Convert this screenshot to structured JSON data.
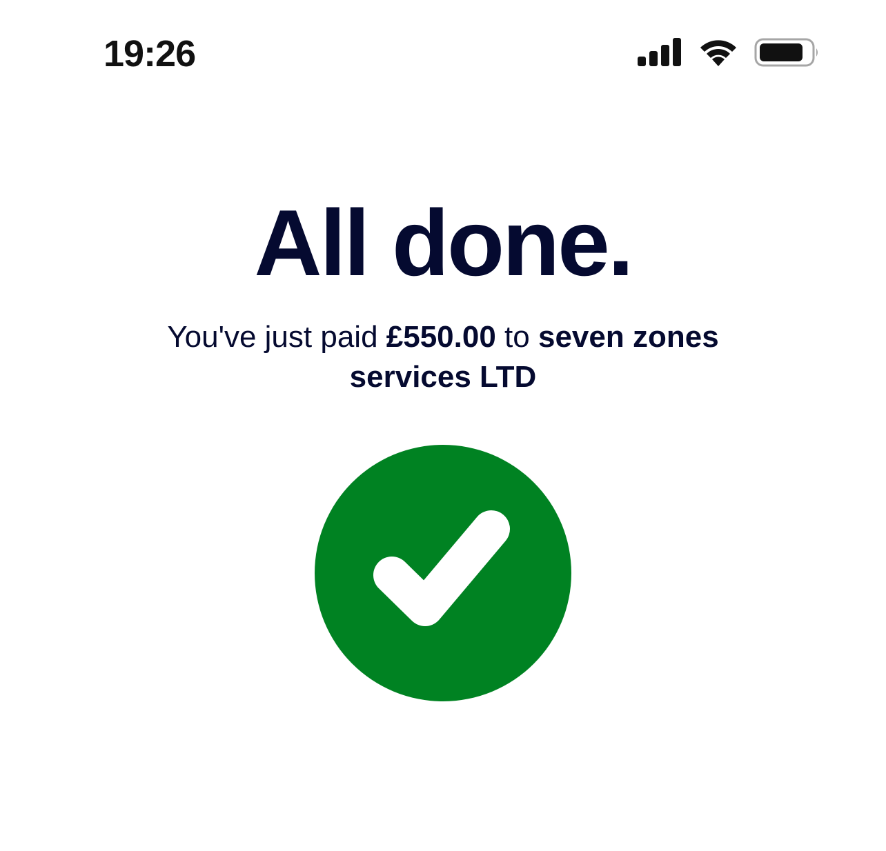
{
  "status_bar": {
    "time": "19:26",
    "icons": [
      "signal-icon",
      "wifi-icon",
      "battery-icon"
    ]
  },
  "confirmation": {
    "title": "All done.",
    "message_prefix": "You've just paid ",
    "amount": "£550.00",
    "message_connector": " to ",
    "payee": "seven zones services LTD"
  },
  "success_icon": {
    "name": "check-circle-icon",
    "color": "#008222"
  },
  "colors": {
    "text": "#050a30",
    "success": "#008222"
  }
}
